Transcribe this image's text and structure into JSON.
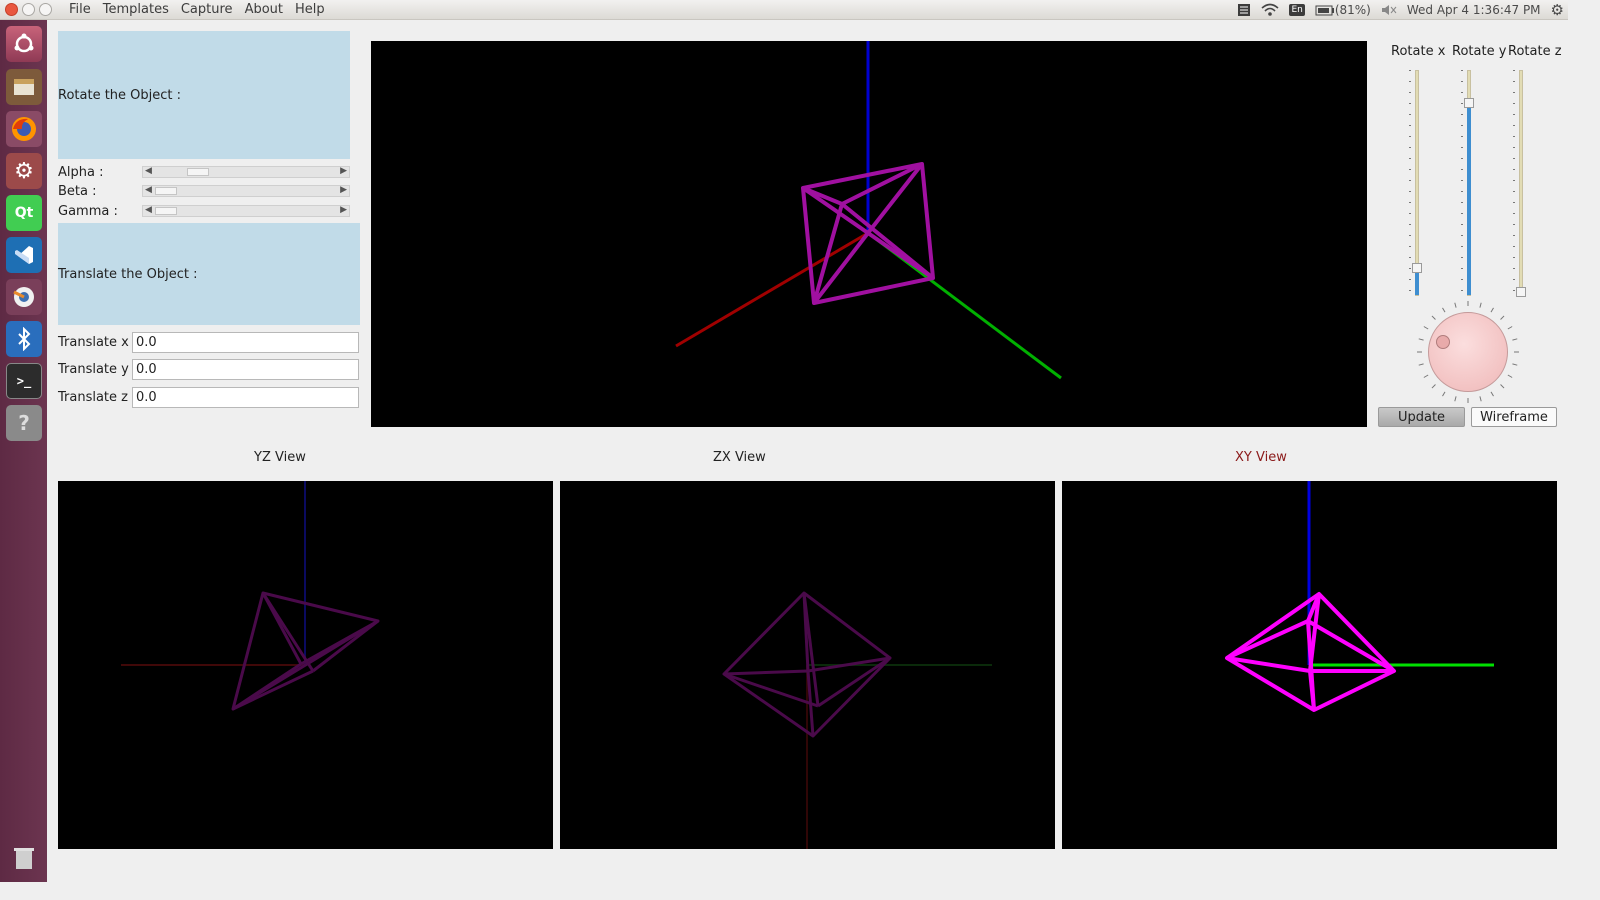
{
  "menubar": {
    "items": [
      "File",
      "Templates",
      "Capture",
      "About",
      "Help"
    ]
  },
  "tray": {
    "keyboard": "En",
    "battery": "(81%)",
    "clock": "Wed Apr  4  1:36:47 PM"
  },
  "launcher": {
    "items": [
      "ubuntu-dash",
      "files",
      "firefox",
      "system-settings",
      "qt-creator",
      "vscode",
      "blender",
      "bluetooth",
      "terminal",
      "help",
      "trash"
    ]
  },
  "rotate": {
    "header": "Rotate the Object :",
    "alpha_label": "Alpha    :",
    "beta_label": "Beta      :",
    "gamma_label": "Gamma  :",
    "alpha_value": 0.25,
    "beta_value": 0.12,
    "gamma_value": 0.12
  },
  "translate": {
    "header": "Translate the Object :",
    "x_label": "Translate x :",
    "y_label": "Translate y :",
    "z_label": "Translate z :",
    "x_value": "0.0",
    "y_value": "0.0",
    "z_value": "0.0"
  },
  "views": {
    "yz_title": "YZ View",
    "zx_title": "ZX View",
    "xy_title": "XY View",
    "xy_title_color": "#8b1a1a"
  },
  "right_panel": {
    "rotate_x_label": "Rotate x",
    "rotate_y_label": "Rotate y",
    "rotate_z_label": "Rotate z",
    "rotate_x_value": 0.13,
    "rotate_y_value": 0.86,
    "rotate_z_value": 0.02,
    "update_label": "Update",
    "wireframe_label": "Wireframe"
  },
  "colors": {
    "axis_x": "#b00000",
    "axis_y": "#00c000",
    "axis_z": "#0000e0",
    "object": "#a010a0",
    "object_bright": "#ff00ff",
    "panel_blue": "#c1dbe8"
  }
}
